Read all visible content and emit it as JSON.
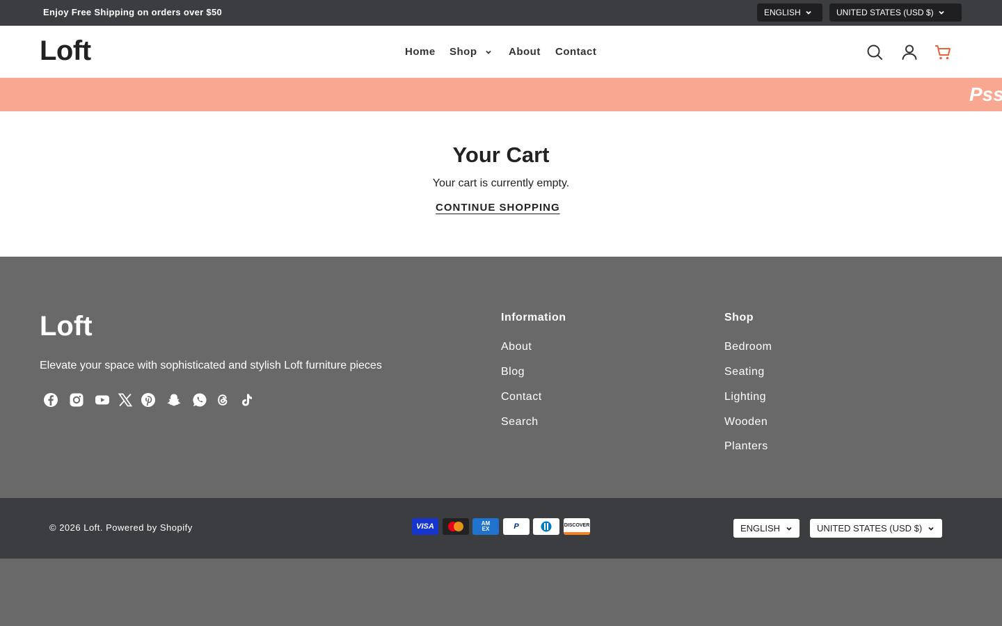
{
  "announcement": {
    "text": "Enjoy Free Shipping on orders over $50"
  },
  "top_selectors": {
    "language": "ENGLISH",
    "country": "UNITED STATES (USD $)"
  },
  "header": {
    "logo": "Loft",
    "nav": [
      {
        "label": "Home"
      },
      {
        "label": "Shop"
      },
      {
        "label": "About"
      },
      {
        "label": "Contact"
      }
    ],
    "icons": [
      "search-icon",
      "account-icon",
      "cart-icon"
    ],
    "cart_icon_color": "#e8623a"
  },
  "promo": {
    "text": "Pss",
    "bg": "#f8a891"
  },
  "cart": {
    "title": "Your Cart",
    "empty_message": "Your cart is currently empty.",
    "cta": "CONTINUE SHOPPING"
  },
  "footer": {
    "logo": "Loft",
    "tagline": "Elevate your space with sophisticated and stylish Loft furniture pieces",
    "social": [
      "facebook-icon",
      "instagram-icon",
      "youtube-icon",
      "x-icon",
      "pinterest-icon",
      "snapchat-icon",
      "whatsapp-icon",
      "threads-icon",
      "tiktok-icon"
    ],
    "columns": [
      {
        "title": "Information",
        "links": [
          "About",
          "Blog",
          "Contact",
          "Search"
        ]
      },
      {
        "title": "Shop",
        "links": [
          "Bedroom",
          "Seating",
          "Lighting",
          "Wooden",
          "Planters"
        ]
      }
    ]
  },
  "bottom_bar": {
    "copyright": "© 2026 Loft. Powered by Shopify",
    "payments": [
      "Visa",
      "Mastercard",
      "American Express",
      "PayPal",
      "Diners Club",
      "Discover"
    ],
    "language": "ENGLISH",
    "country": "UNITED STATES (USD $)"
  }
}
